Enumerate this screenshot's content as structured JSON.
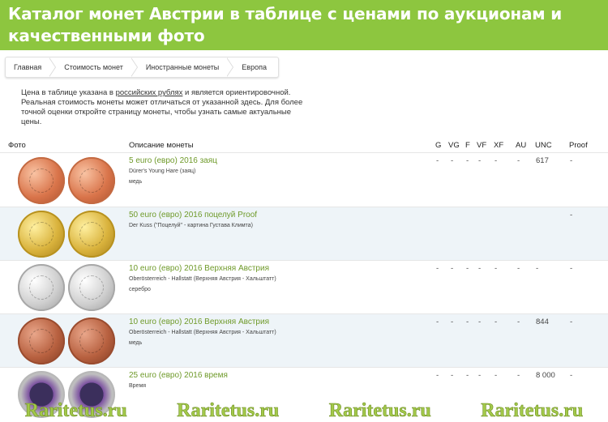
{
  "banner": {
    "title_line1": "Каталог монет Австрии в таблице с ценами по аукционам и",
    "title_line2": "качественными фото"
  },
  "breadcrumbs": [
    "Главная",
    "Стоимость монет",
    "Иностранные монеты",
    "Европа"
  ],
  "note": {
    "part1": "Цена в таблице указана в ",
    "link": "российских рублях",
    "part2": " и является ориентировочной. Реальная стоимость монеты может отличаться от указанной здесь. Для более точной оценки откройте страницу монеты, чтобы узнать самые актуальные цены."
  },
  "table": {
    "headers": {
      "photo": "Фото",
      "description": "Описание монеты",
      "g": "G",
      "vg": "VG",
      "f": "F",
      "vf": "VF",
      "xf": "XF",
      "au": "AU",
      "unc": "UNC",
      "proof": "Proof"
    },
    "rows": [
      {
        "title": "5 euro (евро) 2016 заяц",
        "subtitle": "Dürer's Young Hare (заяц)",
        "material": "медь",
        "coin_color": "copper",
        "g": "-",
        "vg": "-",
        "f": "-",
        "vf": "-",
        "xf": "-",
        "au": "-",
        "unc": "617",
        "proof": "-"
      },
      {
        "title": "50 euro (евро) 2016 поцелуй Proof",
        "subtitle": "Der Kuss (\"Поцелуй\" - картина Густава Климта)",
        "material": "",
        "coin_color": "gold",
        "g": "",
        "vg": "",
        "f": "",
        "vf": "",
        "xf": "",
        "au": "",
        "unc": "",
        "proof": "-"
      },
      {
        "title": "10 euro (евро) 2016 Верхняя Австрия",
        "subtitle": "Oberösterreich - Hallstatt (Верхняя Австрия - Хальштатт)",
        "material": "серебро",
        "coin_color": "silver",
        "g": "-",
        "vg": "-",
        "f": "-",
        "vf": "-",
        "xf": "-",
        "au": "-",
        "unc": "-",
        "proof": "-"
      },
      {
        "title": "10 euro (евро) 2016 Верхняя Австрия",
        "subtitle": "Oberösterreich - Hallstatt (Верхняя Австрия - Хальштатт)",
        "material": "медь",
        "coin_color": "copper2",
        "g": "-",
        "vg": "-",
        "f": "-",
        "vf": "-",
        "xf": "-",
        "au": "-",
        "unc": "844",
        "proof": "-"
      },
      {
        "title": "25 euro (евро) 2016 время",
        "subtitle": "Время",
        "material": "",
        "coin_color": "niobium",
        "g": "-",
        "vg": "-",
        "f": "-",
        "vf": "-",
        "xf": "-",
        "au": "-",
        "unc": "8 000",
        "proof": "-"
      }
    ]
  },
  "watermark": [
    "Raritetus.ru",
    "Raritetus.ru",
    "Raritetus.ru",
    "Raritetus.ru"
  ],
  "colors": {
    "banner": "#8dc63f",
    "link_green": "#6f9a2a",
    "row_alt": "#eef4f8",
    "watermark": "#a3c94a"
  }
}
